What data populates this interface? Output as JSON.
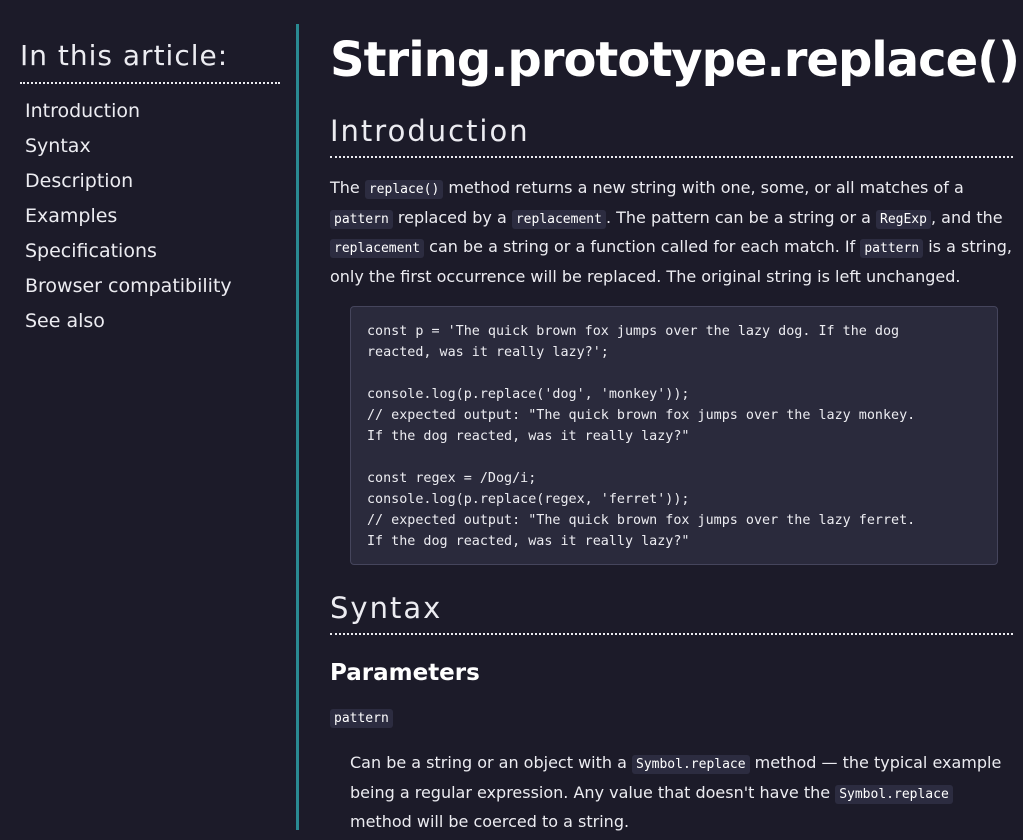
{
  "sidebar": {
    "title": "In this article:",
    "items": [
      {
        "label": "Introduction"
      },
      {
        "label": "Syntax"
      },
      {
        "label": "Description"
      },
      {
        "label": "Examples"
      },
      {
        "label": "Specifications"
      },
      {
        "label": "Browser compatibility"
      },
      {
        "label": "See also"
      }
    ]
  },
  "main": {
    "title": "String.prototype.replace()",
    "intro": {
      "heading": "Introduction",
      "t1": "The ",
      "c1": "replace()",
      "t2": " method returns a new string with one, some, or all matches of a ",
      "c2": "pattern",
      "t3": " replaced by a ",
      "c3": "replacement",
      "t4": ". The pattern can be a string or a ",
      "c4": "RegExp",
      "t5": ", and the ",
      "c5": "replacement",
      "t6": " can be a string or a function called for each match. If ",
      "c6": "pattern",
      "t7": " is a string, only the first occurrence will be replaced. The original string is left unchanged.",
      "code": "const p = 'The quick brown fox jumps over the lazy dog. If the dog\nreacted, was it really lazy?';\n\nconsole.log(p.replace('dog', 'monkey'));\n// expected output: \"The quick brown fox jumps over the lazy monkey.\nIf the dog reacted, was it really lazy?\"\n\nconst regex = /Dog/i;\nconsole.log(p.replace(regex, 'ferret'));\n// expected output: \"The quick brown fox jumps over the lazy ferret.\nIf the dog reacted, was it really lazy?\""
    },
    "syntax": {
      "heading": "Syntax",
      "params_heading": "Parameters",
      "param_name": "pattern",
      "desc": {
        "t1": "Can be a string or an object with a ",
        "c1": "Symbol.replace",
        "t2": " method — the typical example being a regular expression. Any value that doesn't have the ",
        "c2": "Symbol.replace",
        "t3": " method will be coerced to a string."
      }
    }
  }
}
